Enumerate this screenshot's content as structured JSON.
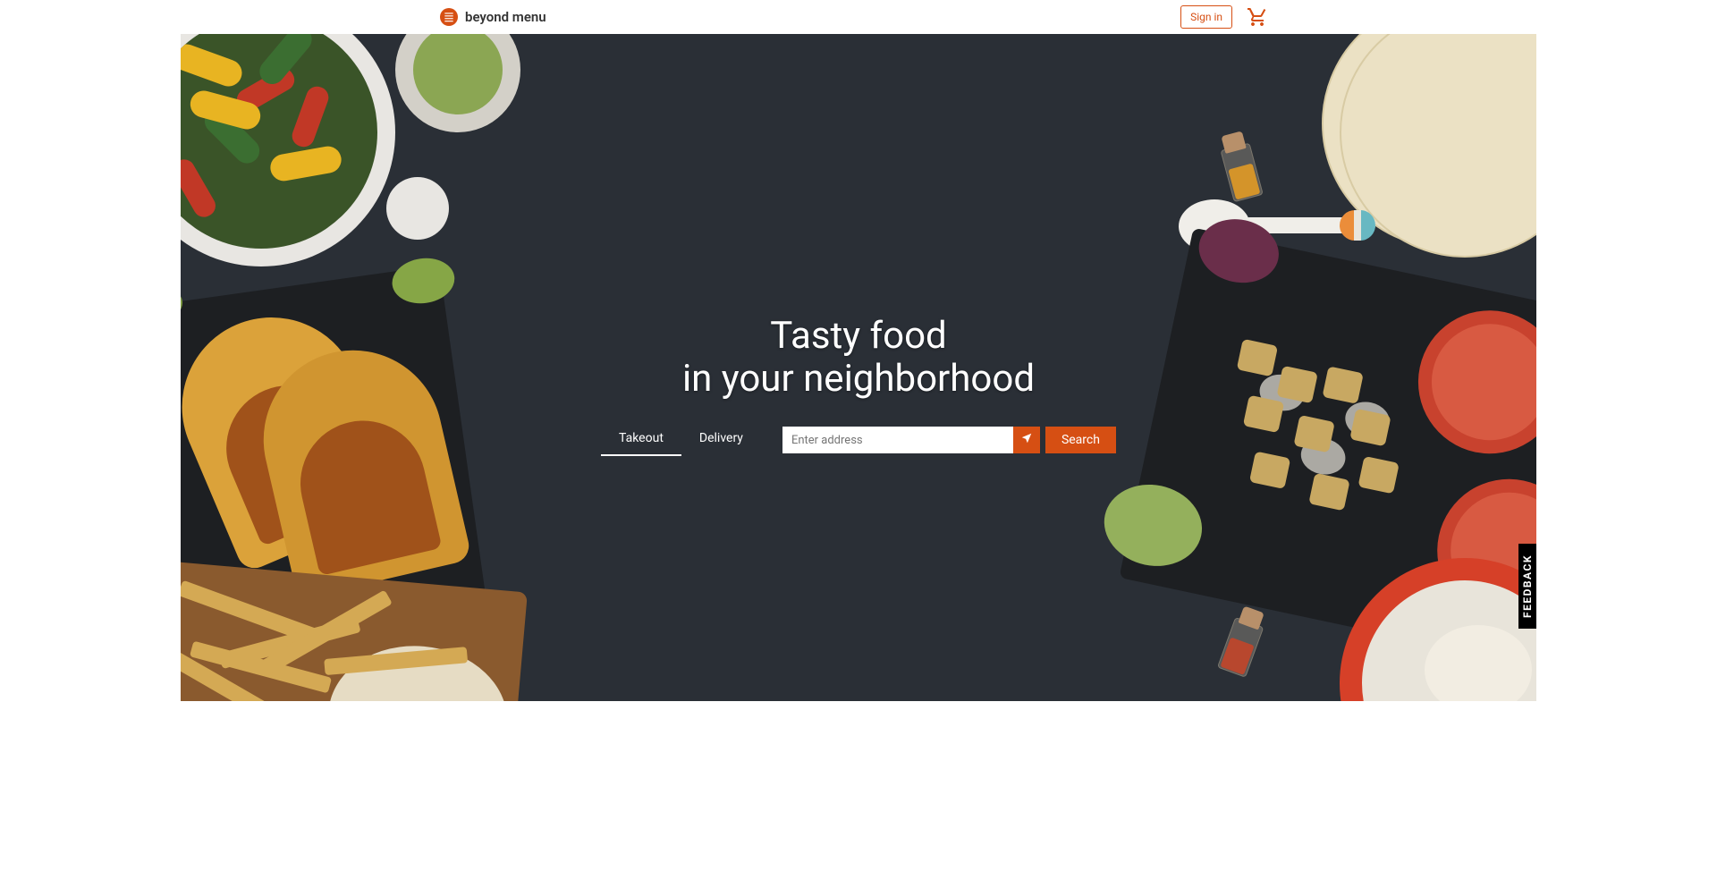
{
  "brand": {
    "name": "beyond menu"
  },
  "header": {
    "signin_label": "Sign in"
  },
  "hero": {
    "title_line1": "Tasty food",
    "title_line2": "in your neighborhood",
    "tabs": {
      "takeout": "Takeout",
      "delivery": "Delivery"
    },
    "address_placeholder": "Enter address",
    "search_label": "Search"
  },
  "feedback": {
    "label": "FEEDBACK"
  },
  "colors": {
    "accent": "#d64f13"
  }
}
